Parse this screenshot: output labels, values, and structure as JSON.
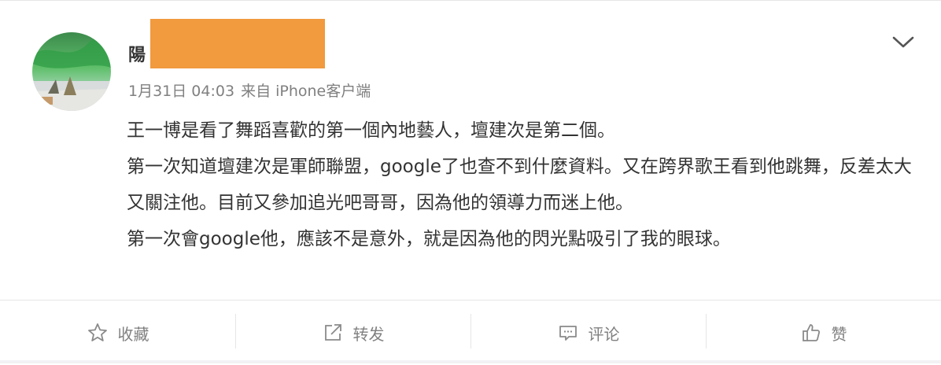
{
  "post": {
    "author_name": "陽",
    "timestamp": "1月31日 04:03",
    "source_prefix": "来自",
    "source_device": "iPhone客户端",
    "paragraphs": [
      "王一博是看了舞蹈喜歡的第一個內地藝人，壇建次是第二個。",
      "第一次知道壇建次是軍師聯盟，google了也查不到什麼資料。又在跨界歌王看到他跳舞，反差太大又關注他。目前又參加追光吧哥哥，因為他的領導力而迷上他。",
      "第一次會google他，應該不是意外，就是因為他的閃光點吸引了我的眼球。"
    ]
  },
  "actions": {
    "favorite_label": "收藏",
    "repost_label": "转发",
    "comment_label": "评论",
    "like_label": "赞"
  },
  "icons": {
    "avatar": "avatar-image",
    "menu": "chevron-down-icon",
    "favorite": "star-icon",
    "repost": "share-icon",
    "comment": "comment-icon",
    "like": "thumbs-up-icon"
  },
  "colors": {
    "redaction": "#f19a3e",
    "muted_text": "#808080",
    "body_text": "#333333"
  }
}
